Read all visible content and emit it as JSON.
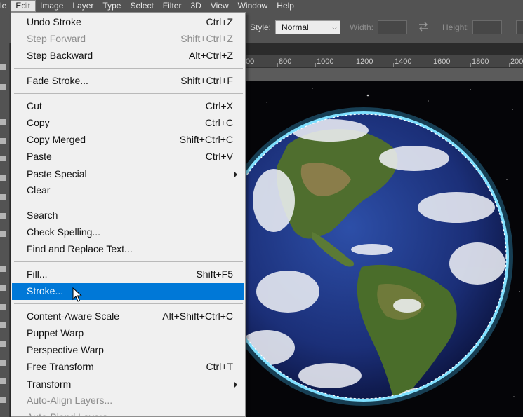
{
  "menubar": {
    "items": [
      "le",
      "Edit",
      "Image",
      "Layer",
      "Type",
      "Select",
      "Filter",
      "3D",
      "View",
      "Window",
      "Help"
    ]
  },
  "options_bar": {
    "style_label": "Style:",
    "style_value": "Normal",
    "width_label": "Width:",
    "height_label": "Height:"
  },
  "ruler": {
    "ticks": [
      "00",
      "800",
      "1000",
      "1200",
      "1400",
      "1600",
      "1800",
      "200"
    ]
  },
  "edit_menu": {
    "items": [
      {
        "label": "Undo Stroke",
        "shortcut": "Ctrl+Z"
      },
      {
        "label": "Step Forward",
        "shortcut": "Shift+Ctrl+Z",
        "disabled": true
      },
      {
        "label": "Step Backward",
        "shortcut": "Alt+Ctrl+Z"
      },
      {
        "label": "Fade Stroke...",
        "shortcut": "Shift+Ctrl+F"
      },
      {
        "label": "Cut",
        "shortcut": "Ctrl+X"
      },
      {
        "label": "Copy",
        "shortcut": "Ctrl+C"
      },
      {
        "label": "Copy Merged",
        "shortcut": "Shift+Ctrl+C"
      },
      {
        "label": "Paste",
        "shortcut": "Ctrl+V"
      },
      {
        "label": "Paste Special",
        "shortcut": "",
        "submenu": true
      },
      {
        "label": "Clear",
        "shortcut": ""
      },
      {
        "label": "Search",
        "shortcut": ""
      },
      {
        "label": "Check Spelling...",
        "shortcut": ""
      },
      {
        "label": "Find and Replace Text...",
        "shortcut": ""
      },
      {
        "label": "Fill...",
        "shortcut": "Shift+F5"
      },
      {
        "label": "Stroke...",
        "shortcut": "",
        "highlighted": true
      },
      {
        "label": "Content-Aware Scale",
        "shortcut": "Alt+Shift+Ctrl+C"
      },
      {
        "label": "Puppet Warp",
        "shortcut": ""
      },
      {
        "label": "Perspective Warp",
        "shortcut": ""
      },
      {
        "label": "Free Transform",
        "shortcut": "Ctrl+T"
      },
      {
        "label": "Transform",
        "shortcut": "",
        "submenu": true
      },
      {
        "label": "Auto-Align Layers...",
        "shortcut": "",
        "disabled": true
      },
      {
        "label": "Auto-Blend Layers...",
        "shortcut": "",
        "disabled": true
      }
    ]
  },
  "colors": {
    "highlight": "#0078d7",
    "menu_bg": "#f0f0f0",
    "chrome": "#535353",
    "selection_stroke": "#7fe0ff"
  }
}
